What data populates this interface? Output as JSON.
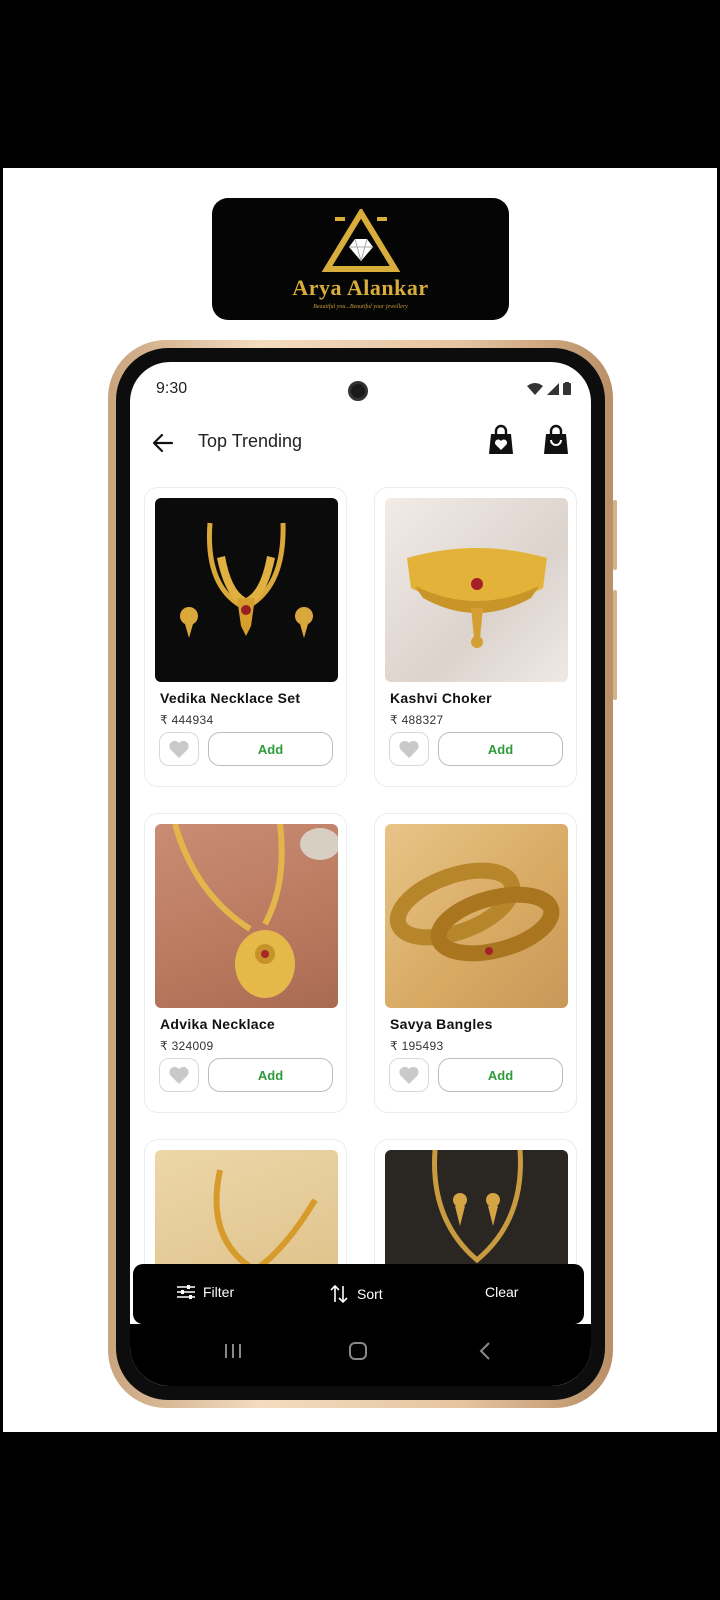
{
  "brand": {
    "name": "Arya Alankar",
    "tagline": "Beautiful you...Beautiful your jewellery",
    "gold": "#d9ad3c"
  },
  "status": {
    "time": "9:30",
    "icons": [
      "wifi-icon",
      "signal-icon",
      "battery-icon"
    ]
  },
  "header": {
    "title": "Top Trending",
    "back_icon": "arrow-left-icon",
    "wishlist_icon": "bag-heart-icon",
    "cart_icon": "shopping-bag-icon"
  },
  "products": [
    {
      "name": "Vedika Necklace Set",
      "price": "₹ 444934",
      "add_label": "Add"
    },
    {
      "name": "Kashvi Choker",
      "price": "₹ 488327",
      "add_label": "Add"
    },
    {
      "name": "Advika Necklace",
      "price": "₹ 324009",
      "add_label": "Add"
    },
    {
      "name": "Savya Bangles",
      "price": "₹ 195493",
      "add_label": "Add"
    },
    {
      "name": "",
      "price": "",
      "add_label": ""
    },
    {
      "name": "",
      "price": "",
      "add_label": ""
    }
  ],
  "bottom_bar": {
    "filter": "Filter",
    "sort": "Sort",
    "clear": "Clear"
  },
  "colors": {
    "accent_green": "#2e9a3a",
    "bar": "#000000"
  }
}
